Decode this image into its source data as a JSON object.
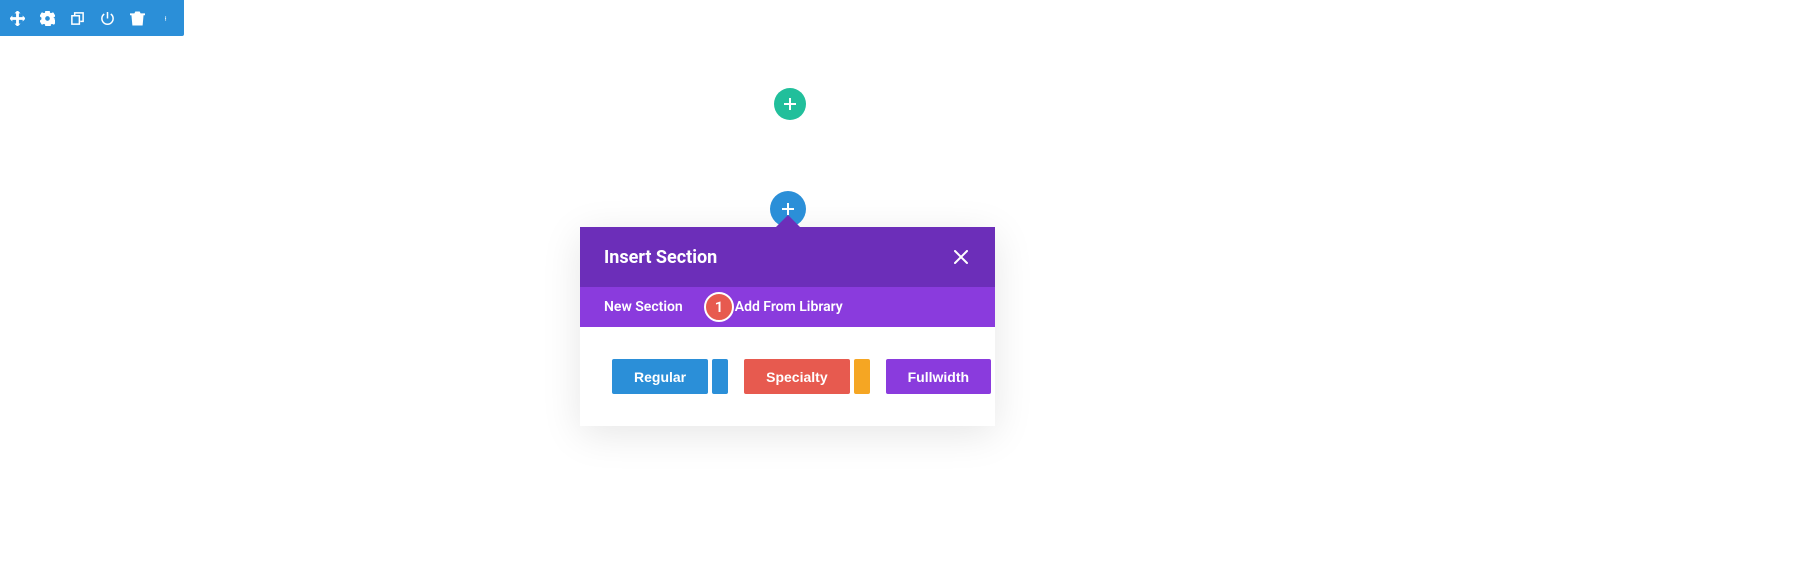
{
  "toolbar": {
    "icons": [
      "move",
      "gear",
      "duplicate",
      "power",
      "trash",
      "more"
    ]
  },
  "add_buttons": {
    "green_plus": "+",
    "blue_plus": "+"
  },
  "modal": {
    "title": "Insert Section",
    "close": "×",
    "tabs": {
      "new_section": "New Section",
      "add_from_library": "Add From Library"
    },
    "step_badge": "1",
    "section_types": {
      "regular": "Regular",
      "specialty": "Specialty",
      "fullwidth": "Fullwidth"
    }
  }
}
